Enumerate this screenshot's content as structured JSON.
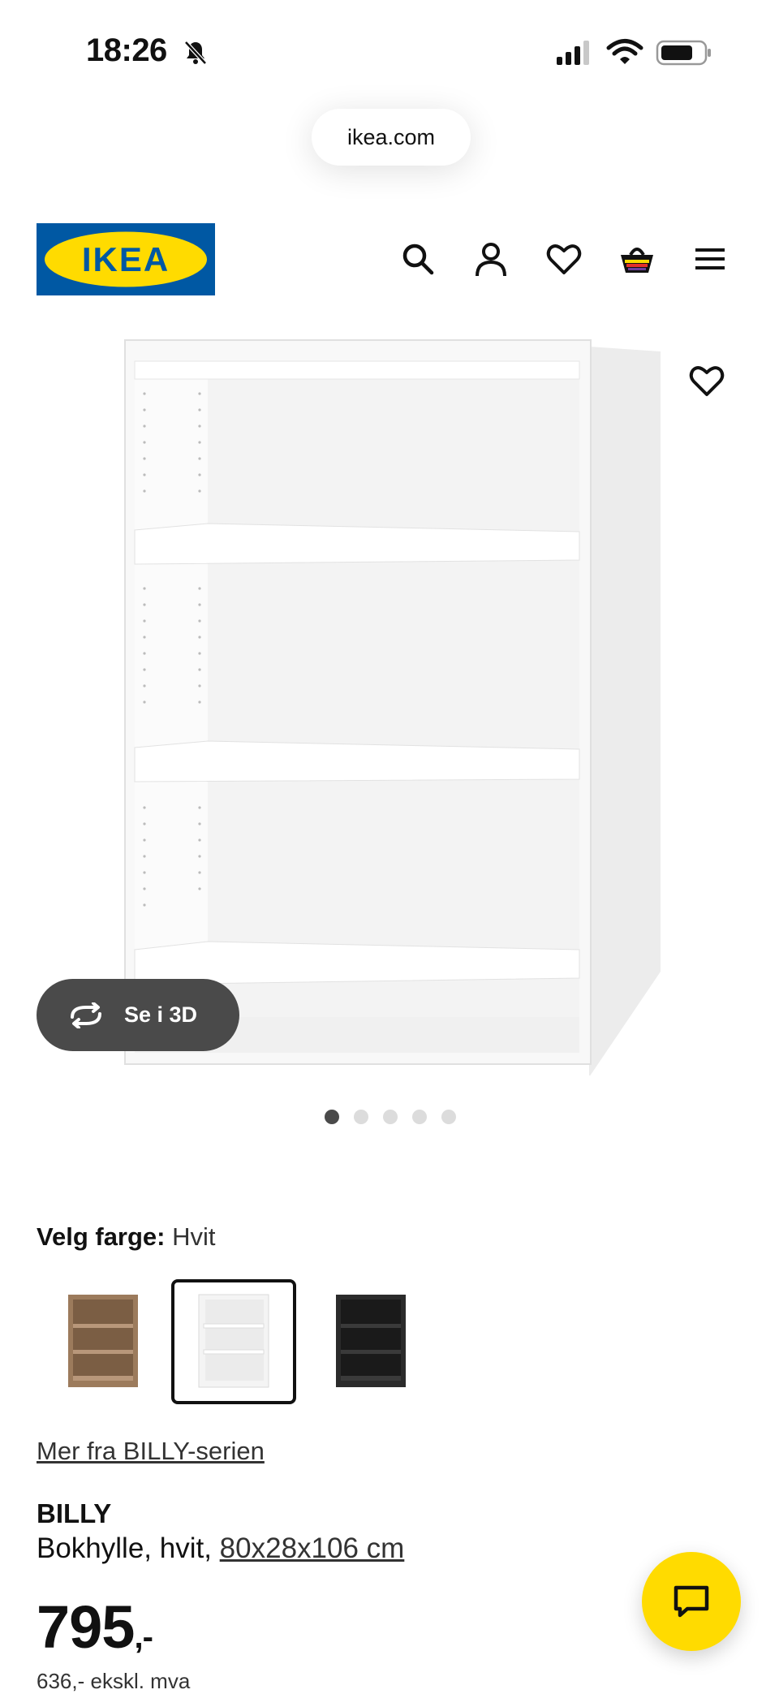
{
  "status_bar": {
    "time": "18:26",
    "icons": [
      "bell-slash-icon",
      "cellular-signal-icon",
      "wifi-icon",
      "battery-icon"
    ]
  },
  "browser": {
    "url": "ikea.com"
  },
  "header": {
    "logo_text": "IKEA",
    "icons": [
      "search-icon",
      "account-icon",
      "heart-icon",
      "cart-icon",
      "menu-icon"
    ]
  },
  "gallery": {
    "view_3d_label": "Se i 3D",
    "dots": 5,
    "active_dot": 1
  },
  "color": {
    "label": "Velg farge:",
    "value": "Hvit",
    "swatches": [
      "brown-ash-bookcase",
      "white-bookcase",
      "black-bookcase"
    ]
  },
  "product": {
    "series_link": "Mer fra BILLY-serien",
    "name": "BILLY",
    "description": "Bokhylle, hvit,",
    "dimensions": "80x28x106 cm",
    "price_main": "795",
    "price_suffix": ",-",
    "price_excl_vat": "636,- ekskl. mva"
  },
  "colors": {
    "brand_blue": "#0058a3",
    "brand_yellow": "#ffdb00"
  }
}
